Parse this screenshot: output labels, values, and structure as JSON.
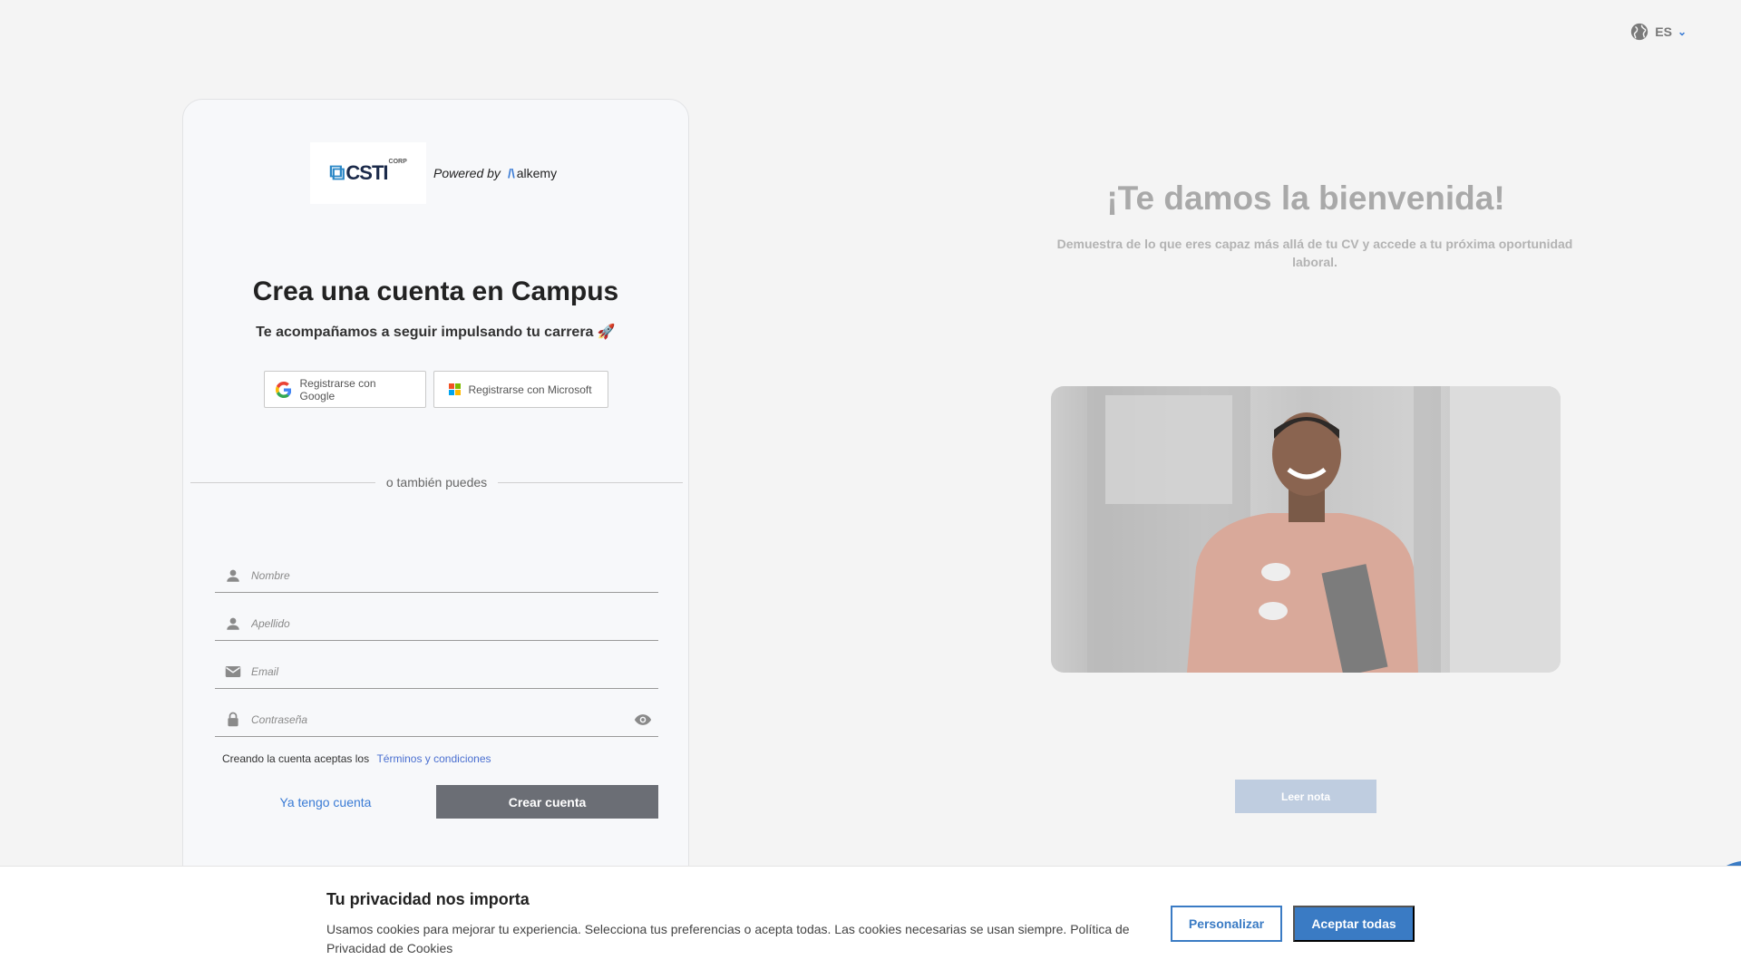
{
  "language": {
    "code": "ES",
    "icon": "globe-icon"
  },
  "brand": {
    "logo_text": "CSTI",
    "logo_suffix": "CORP",
    "powered_by": "Powered by",
    "partner_name": "alkemy"
  },
  "signup": {
    "title": "Crea una cuenta en Campus",
    "subtitle": "Te acompañamos a seguir impulsando tu carrera 🚀",
    "google_label": "Registrarse con Google",
    "microsoft_label": "Registrarse con Microsoft",
    "divider_text": "o también puedes",
    "fields": {
      "first_name": "Nombre",
      "last_name": "Apellido",
      "email": "Email",
      "password": "Contraseña"
    },
    "terms_prefix": "Creando la cuenta aceptas los",
    "terms_link": "Términos y condiciones",
    "login_link": "Ya tengo cuenta",
    "submit_label": "Crear cuenta"
  },
  "welcome": {
    "title": "¡Te damos la bienvenida!",
    "subtitle": "Demuestra de lo que eres capaz más allá de tu CV y accede a tu próxima oportunidad laboral.",
    "read_button": "Leer nota"
  },
  "cookies": {
    "title": "Tu privacidad nos importa",
    "text": "Usamos cookies para mejorar tu experiencia. Selecciona tus preferencias o acepta todas. Las cookies necesarias se usan siempre. Política de Privacidad de Cookies",
    "customize_label": "Personalizar",
    "accept_label": "Aceptar todas"
  },
  "colors": {
    "accent": "#3a7bc4",
    "primary_button": "#6b6e75",
    "background": "#f4f4f4"
  }
}
